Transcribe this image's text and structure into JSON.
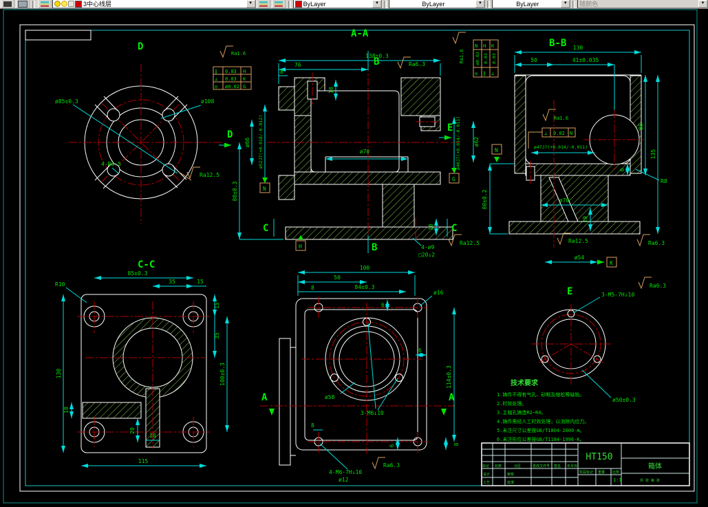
{
  "toolbar": {
    "layer_dropdown": {
      "value": "3中心线层"
    },
    "color_dropdown": {
      "value": "ByLayer"
    },
    "linetype_dropdown": {
      "value": "ByLayer"
    },
    "lineweight_dropdown": {
      "value": "ByLayer"
    },
    "plotstyle_dropdown": {
      "value": "随颜色"
    }
  },
  "colors": {
    "dim_line": "#00dcdc",
    "dim_text": "#00e400",
    "outline": "#ffffff",
    "centerline": "#b40000",
    "hatch": "#7fb949",
    "tol_frame": "#d9a05f"
  },
  "views": {
    "d": {
      "label": "D",
      "side_label": "D",
      "dia85": "ø85±0.3",
      "dia108": "ø108",
      "slots": "4-R3.5",
      "ra125": "Ra12.5",
      "ra16": "Ra1.6",
      "tol": [
        [
          "∥",
          "0.03",
          "H"
        ],
        [
          "⊥",
          "0.03",
          "K"
        ],
        [
          "◎",
          "ø0.02",
          "G"
        ]
      ]
    },
    "aa": {
      "label": "A-A",
      "b": "B",
      "c": "C",
      "e": "E",
      "d138": "138±0.3",
      "d76": "76",
      "d8": "8",
      "d18": "18",
      "d70": "ø70",
      "ra63": "Ra6.3",
      "d66": "ø66",
      "d52": "ø52J7(+0.018/-0.012)",
      "d80": "80±0.3",
      "d40": "ø40J7(+0.014/-0.011)",
      "d62": "ø62",
      "d10": "10",
      "holes": "4-ø9",
      "cbore": "□20↓2",
      "ra125": "Ra12.5",
      "datum_n": "N",
      "datum_h": "H",
      "datum_g": "G",
      "ra16": "Ra1.6",
      "tol": [
        [
          "◎",
          "ø0.02",
          "N"
        ],
        [
          "∥",
          "0.03",
          "H"
        ],
        [
          "⊥",
          "0.03",
          "K"
        ]
      ]
    },
    "bb": {
      "label": "B-B",
      "d130": "130",
      "d50": "50",
      "d41": "41±0.035",
      "d86": "86",
      "d135": "135",
      "r8": "R8",
      "d70": "ø70",
      "d19": "19",
      "d54": "ø54",
      "ra125": "Ra12.5",
      "ra63": "Ra6.3",
      "ra16": "Ra1.6",
      "d47": "ø47J7(+0.014/-0.011)",
      "d80": "80±0.2",
      "d6": "6",
      "datum_n": "N",
      "datum_k": "K",
      "tol": [
        "⊥",
        "0.02",
        "N"
      ]
    },
    "cc": {
      "label": "C-C",
      "d85": "85±0.3",
      "d35t": "35",
      "d15t": "15",
      "r10": "R10",
      "d15r": "15",
      "d35r": "35",
      "d130": "130",
      "d100": "100±0.3",
      "d10l": "10",
      "d10b": "10",
      "d20": "20",
      "d115": "115"
    },
    "plan": {
      "a": "A",
      "d100": "100",
      "d50": "50",
      "d8a": "8",
      "d84": "84±0.3",
      "d16": "ø16",
      "d6a": "6",
      "d6b": "6",
      "d114": "114±0.3",
      "d58": "ø58",
      "m6": "3-M6↓10",
      "d8b": "8",
      "d6c": "6",
      "d8c": "8",
      "m6x4": "4-M6-7H↓10",
      "d12": "ø12",
      "ra63": "Ra6.3"
    },
    "e": {
      "label": "E",
      "m5": "3-M5-7H↓10",
      "d50": "ø50±0.3",
      "ra63": "Ra6.3"
    }
  },
  "tech": {
    "title": "技术要求",
    "items": [
      "1.铸件不得有气孔、砂眼及缩松等缺陷。",
      "2.时效处理。",
      "3.主轴孔铸造R2~R4。",
      "4.铸件需经人工时效处理，以消除内应力。",
      "5.未注尺寸公差按GB/T1804-2000-m。",
      "6.未注形位公差按GB/T1184-1996-K。"
    ]
  },
  "title_block": {
    "material": "HT150",
    "part": "箱体",
    "scale": "1:1",
    "headers": [
      "标记",
      "处数",
      "分区",
      "更改文件号",
      "签名",
      "年月日"
    ],
    "rows": [
      "设计",
      "工艺"
    ],
    "col2": [
      "审核",
      "批准"
    ],
    "stage": "阶段标记",
    "weight": "重量",
    "scale_label": "比例",
    "sheets": "共 张 第 张"
  }
}
